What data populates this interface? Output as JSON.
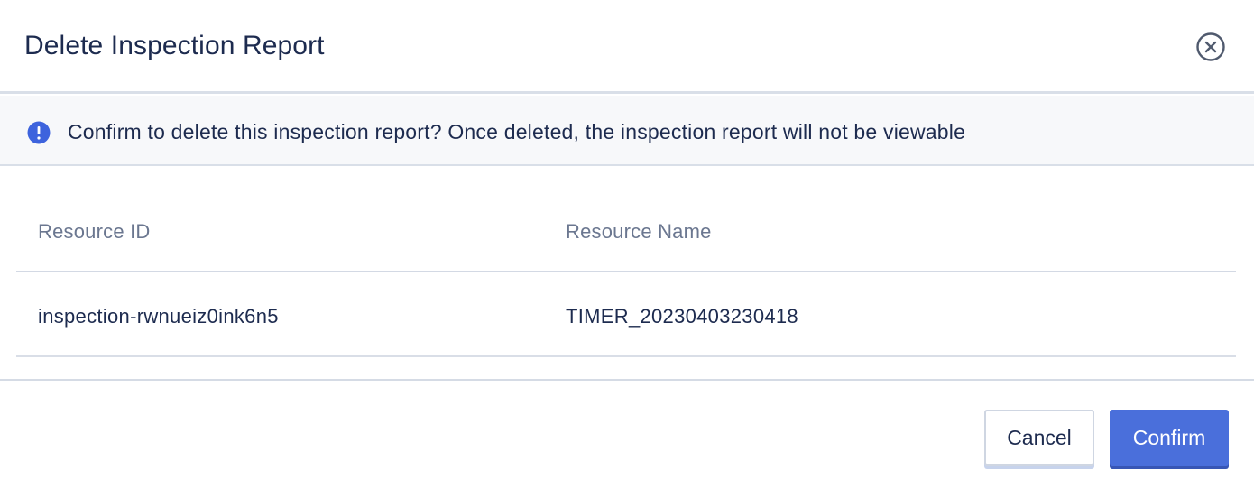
{
  "dialog": {
    "title": "Delete Inspection Report",
    "close_icon": "close-circle-icon"
  },
  "notice": {
    "icon": "exclamation-circle-icon",
    "text": "Confirm to delete this inspection report? Once deleted, the inspection report will not be viewable",
    "icon_color": "#3d63dd"
  },
  "table": {
    "columns": [
      "Resource ID",
      "Resource Name"
    ],
    "rows": [
      [
        "inspection-rwnueiz0ink6n5",
        "TIMER_20230403230418"
      ]
    ]
  },
  "buttons": {
    "cancel_label": "Cancel",
    "confirm_label": "Confirm"
  },
  "colors": {
    "primary": "#4a6fdb",
    "text": "#1d2b4f",
    "muted_text": "#6b7790",
    "notice_bg": "#f7f8fa"
  }
}
